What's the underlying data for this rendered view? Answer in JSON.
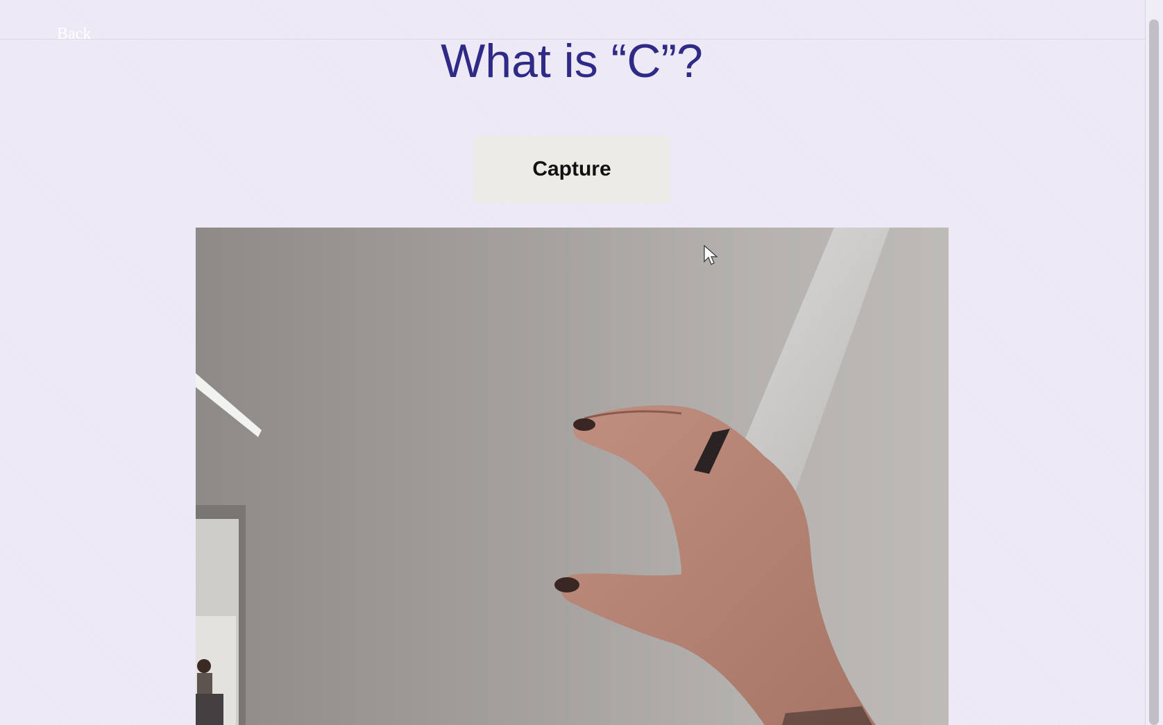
{
  "nav": {
    "back_label": "Back"
  },
  "page": {
    "title": "What is “C”?"
  },
  "actions": {
    "capture_label": "Capture"
  },
  "icons": {
    "cursor": "mouse-pointer-icon"
  },
  "colors": {
    "background": "#ebe7f5",
    "title": "#2e2a86",
    "button_bg": "#ecebe6"
  }
}
